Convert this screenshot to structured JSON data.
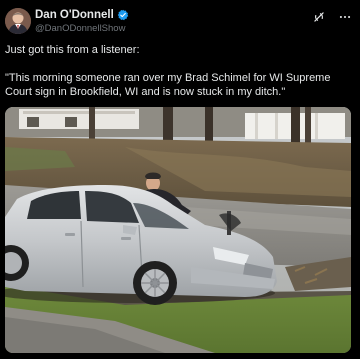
{
  "author": {
    "name": "Dan O'Donnell",
    "handle": "@DanODonnellShow",
    "verified": true,
    "avatar_icon": "avatar-photo"
  },
  "actions": {
    "grok_icon": "grok-icon",
    "more_icon": "more-options-icon"
  },
  "post": {
    "line1": "Just got this from a listener:",
    "line2": "\"This morning someone ran over my Brad Schimel for WI Supreme Court sign in Brookfield, WI and is now stuck in my ditch.\""
  },
  "media": {
    "kind": "photo",
    "depicts": "silver-sedan-stuck-in-ditch"
  },
  "colors": {
    "background": "#000000",
    "text": "#e7e9ea",
    "muted": "#71767b",
    "verified_blue": "#1d9bf0"
  }
}
